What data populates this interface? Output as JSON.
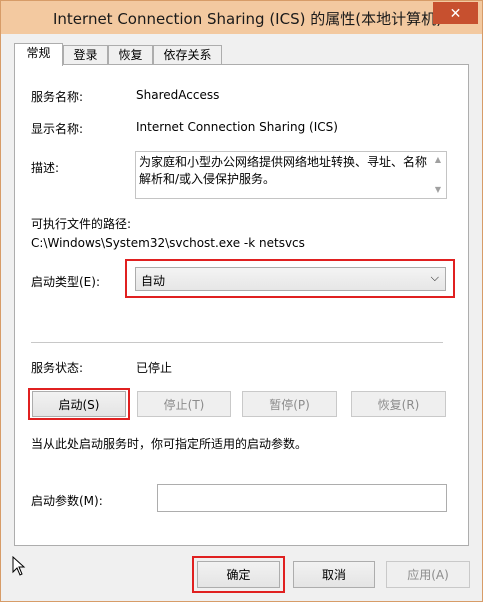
{
  "window": {
    "title": "Internet Connection Sharing (ICS) 的属性(本地计算机)",
    "close_glyph": "✕"
  },
  "tabs": [
    {
      "label": "常规",
      "active": true
    },
    {
      "label": "登录",
      "active": false
    },
    {
      "label": "恢复",
      "active": false
    },
    {
      "label": "依存关系",
      "active": false
    }
  ],
  "general": {
    "service_name_label": "服务名称:",
    "service_name": "SharedAccess",
    "display_name_label": "显示名称:",
    "display_name": "Internet Connection Sharing (ICS)",
    "description_label": "描述:",
    "description": "为家庭和小型办公网络提供网络地址转换、寻址、名称解析和/或入侵保护服务。",
    "path_label": "可执行文件的路径:",
    "path": "C:\\Windows\\System32\\svchost.exe -k netsvcs",
    "startup_type_label": "启动类型(E):",
    "startup_type": "自动",
    "status_label": "服务状态:",
    "status": "已停止",
    "buttons": {
      "start": "启动(S)",
      "stop": "停止(T)",
      "pause": "暂停(P)",
      "resume": "恢复(R)"
    },
    "hint": "当从此处启动服务时，你可指定所适用的启动参数。",
    "params_label": "启动参数(M):",
    "params_value": ""
  },
  "footer": {
    "ok": "确定",
    "cancel": "取消",
    "apply": "应用(A)"
  },
  "colors": {
    "titlebar": "#f3c9a0",
    "close": "#c7502f",
    "highlight": "#e02020"
  }
}
